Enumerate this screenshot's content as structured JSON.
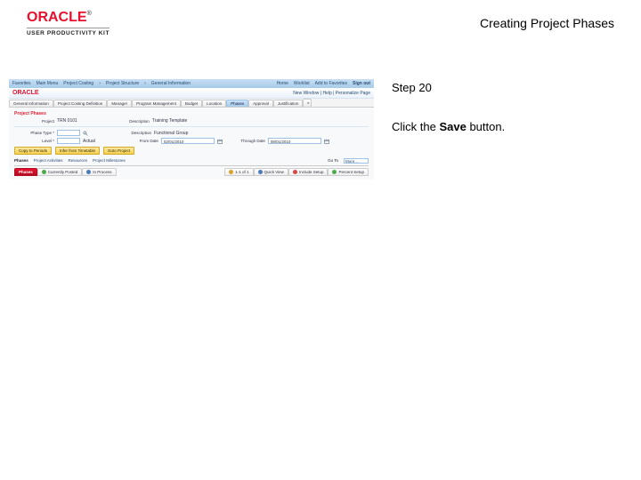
{
  "header": {
    "brand": "ORACLE",
    "brand_sub": "USER PRODUCTIVITY KIT",
    "page_title": "Creating Project Phases"
  },
  "instruction": {
    "step": "Step 20",
    "text_prefix": "Click the ",
    "bold_word": "Save",
    "text_suffix": " button."
  },
  "app": {
    "topbar": {
      "items": [
        "Favorites",
        "Main Menu",
        "Project Costing",
        "Project Structure",
        "General Information"
      ],
      "home": "Home",
      "worklist": "Worklist",
      "addfav": "Add to Favorites",
      "signin": "Sign out"
    },
    "brandrow": {
      "crumb": "New Window | Help | Personalize Page"
    },
    "tabs": [
      "General Information",
      "Project Costing Definition",
      "Manager",
      "Program Management",
      "Budget",
      "Location",
      "Phases",
      "Approval",
      "Justification"
    ],
    "form": {
      "section_title": "Project Phases",
      "project_label": "Project",
      "project_value": "TRN 0101",
      "desc_label": "Description",
      "desc_value": "Training Template",
      "type_label": "Phase Type *",
      "type_icon": "search",
      "desc2_label": "Description",
      "desc2_value": "Functional Group",
      "level_label": "Level *",
      "level_value": "Actual",
      "from_label": "From Date",
      "from_value": "02/01/2010",
      "thru_label": "Through Date",
      "thru_value": "08/01/2010"
    },
    "buttons": [
      "Copy to Periods",
      "Infer from Timetable",
      "Goto Project"
    ],
    "subtabs": {
      "items": [
        "Phases",
        "Project Activities",
        "Resources",
        "Project Milestones"
      ],
      "goto": "Go To",
      "goto_value": "More..."
    },
    "bottom_tabs": {
      "tab1": "Phases",
      "tab2": "Currently Posted",
      "tab3": "In Process",
      "shown": "1-1 of 1",
      "quickview": "Quick View",
      "incsetup": "Include Setup",
      "pctsetup": "Percent Setup"
    }
  }
}
